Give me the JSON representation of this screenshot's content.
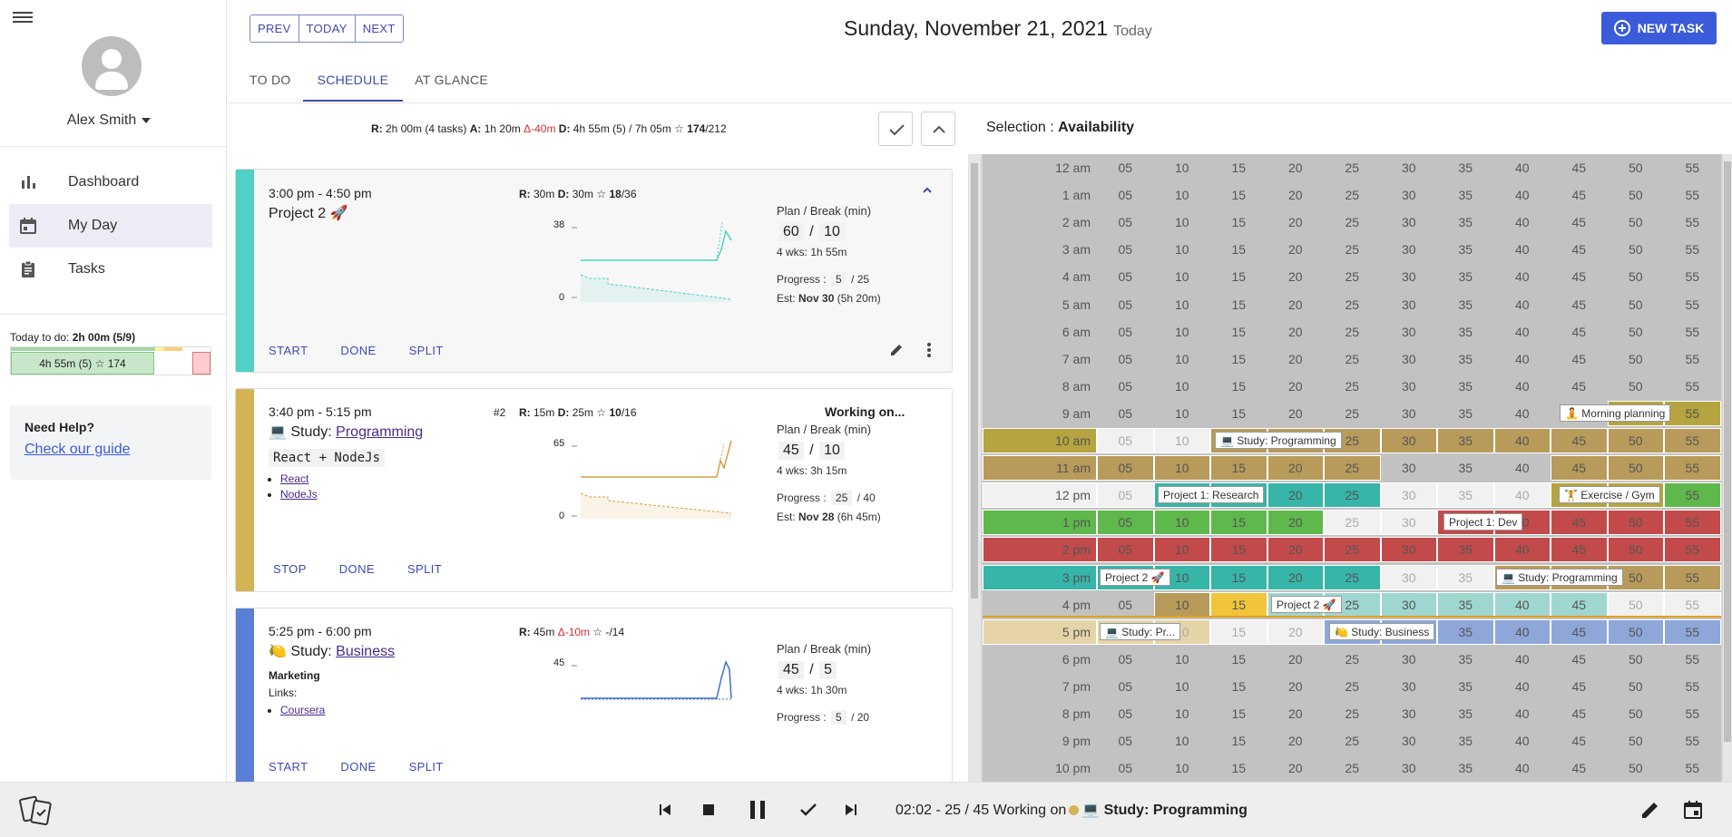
{
  "sidebar": {
    "user_name": "Alex Smith",
    "nav": [
      {
        "label": "Dashboard",
        "icon": "bar-chart-icon"
      },
      {
        "label": "My Day",
        "icon": "calendar-icon"
      },
      {
        "label": "Tasks",
        "icon": "clipboard-icon"
      }
    ],
    "todo_summary_prefix": "Today to do: ",
    "todo_summary_value": "2h 00m (5/9)",
    "todo_bar_text": "4h 55m (5) ☆ 174",
    "help_title": "Need Help?",
    "help_link": "Check our guide"
  },
  "header": {
    "prev": "PREV",
    "today_btn": "TODAY",
    "next": "NEXT",
    "date": "Sunday, November 21, 2021",
    "date_sub": "Today",
    "new_task": "NEW TASK",
    "tabs": [
      "TO DO",
      "SCHEDULE",
      "AT GLANCE"
    ],
    "active_tab": "SCHEDULE"
  },
  "summary": {
    "r": "R:",
    "r_val": " 2h 00m (4 tasks) ",
    "a": "A:",
    "a_val": " 1h 20m ",
    "a_delta": "Δ-40m",
    "d": " D:",
    "d_val": " 4h 55m (5) / 7h 05m ☆ ",
    "d_score": "174",
    "d_total": "/212"
  },
  "tasks": [
    {
      "time": "3:00 pm - 4:50 pm",
      "title": "Project 2 🚀",
      "stats_r": "R:",
      "stats_r_val": " 30m ",
      "stats_d": "D:",
      "stats_d_val": " 30m ☆ ",
      "stats_score": "18",
      "stats_total": "/36",
      "chart_max": "38",
      "chart_min": "0",
      "plan_label": "Plan / Break (min)",
      "plan": "60",
      "break": "10",
      "weeks": "4 wks: 1h 55m",
      "progress_label": "Progress :",
      "progress": "5",
      "progress_total": "/ 25",
      "est_label": "Est:",
      "est": "Nov 30",
      "est_extra": "(5h 20m)",
      "actions": [
        "START",
        "DONE",
        "SPLIT"
      ],
      "color": "#4fd1c5"
    },
    {
      "time": "3:40 pm - 5:15 pm",
      "title_prefix": "💻 Study: ",
      "title_link": "Programming",
      "num": "#2",
      "stats_r": "R:",
      "stats_r_val": " 15m ",
      "stats_d": "D:",
      "stats_d_val": " 25m ☆ ",
      "stats_score": "10",
      "stats_total": "/16",
      "status": "Working on...",
      "description": "React + NodeJs",
      "links": [
        "React",
        "NodeJs"
      ],
      "chart_max": "65",
      "chart_min": "0",
      "plan_label": "Plan / Break (min)",
      "plan": "45",
      "break": "10",
      "weeks": "4 wks: 3h 15m",
      "progress_label": "Progress :",
      "progress": "25",
      "progress_total": "/ 40",
      "est_label": "Est:",
      "est": "Nov 28",
      "est_extra": "(6h 45m)",
      "actions": [
        "STOP",
        "DONE",
        "SPLIT"
      ],
      "color": "#d4b354"
    },
    {
      "time": "5:25 pm - 6:00 pm",
      "title_prefix": "🍋 Study: ",
      "title_link": "Business",
      "stats_r": "R:",
      "stats_r_val": " 45m ",
      "stats_delta": "Δ-10m",
      "stats_tail": " ☆ -/14",
      "heading": "Marketing",
      "links_label": "Links:",
      "links": [
        "Coursera"
      ],
      "chart_max": "45",
      "plan_label": "Plan / Break (min)",
      "plan": "45",
      "break": "5",
      "weeks": "4 wks: 1h 30m",
      "progress_label": "Progress :",
      "progress": "5",
      "progress_total": "/ 20",
      "actions": [
        "START",
        "DONE",
        "SPLIT"
      ],
      "color": "#5b7fd6"
    }
  ],
  "selection": {
    "label": "Selection : ",
    "value": "Availability"
  },
  "grid": {
    "hours": [
      "12 am",
      "1 am",
      "2 am",
      "3 am",
      "4 am",
      "5 am",
      "6 am",
      "7 am",
      "8 am",
      "9 am",
      "10 am",
      "11 am",
      "12 pm",
      "1 pm",
      "2 pm",
      "3 pm",
      "4 pm",
      "5 pm",
      "6 pm",
      "7 pm",
      "8 pm",
      "9 pm",
      "10 pm"
    ],
    "minutes": [
      "05",
      "10",
      "15",
      "20",
      "25",
      "30",
      "35",
      "40",
      "45",
      "50",
      "55"
    ],
    "tags": [
      {
        "text": "🧘 Morning planning"
      },
      {
        "text": "💻 Study: Programming"
      },
      {
        "text": "Project 1: Research"
      },
      {
        "text": "🏋 Exercise / Gym"
      },
      {
        "text": "Project 1: Dev"
      },
      {
        "text": "Project 2 🚀"
      },
      {
        "text": "💻 Study: Programming"
      },
      {
        "text": "Project 2 🚀"
      },
      {
        "text": "💻 Study: Pr..."
      },
      {
        "text": "🍋 Study: Business"
      }
    ]
  },
  "player": {
    "status": "02:02 - 25 / 45 Working on",
    "task": "💻 Study: Programming"
  }
}
